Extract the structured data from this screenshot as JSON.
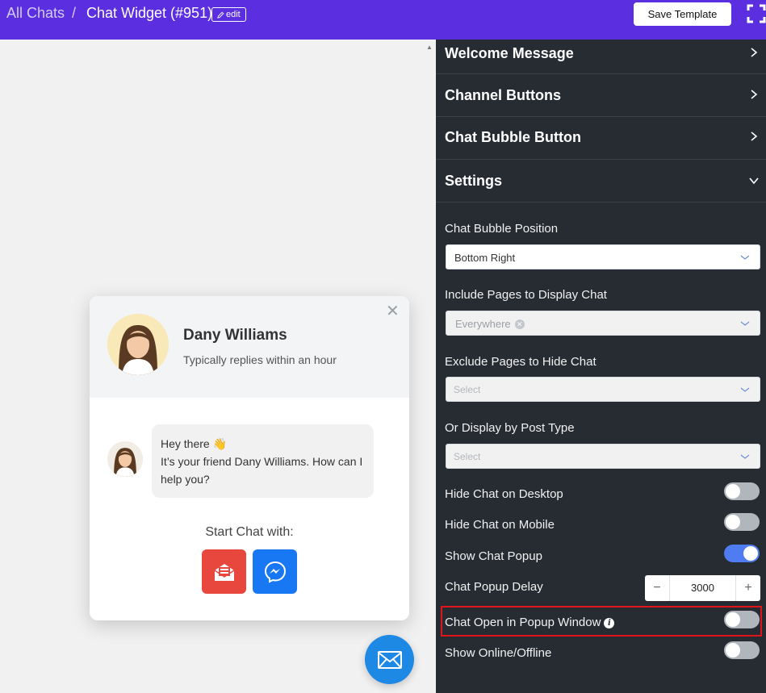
{
  "header": {
    "breadcrumb_root": "All Chats",
    "breadcrumb_sep": "/",
    "breadcrumb_current": "Chat Widget (#951)",
    "edit_label": "edit",
    "save_label": "Save Template",
    "background_color": "#5b2ee0"
  },
  "widget": {
    "agent_name": "Dany Williams",
    "agent_status": "Typically replies within an hour",
    "close_icon": "close-icon",
    "message_line1": "Hey there 👋",
    "message_line2": "It’s your friend Dany Williams. How can I help you?",
    "start_chat_label": "Start Chat with:",
    "channels": [
      {
        "icon": "email-icon",
        "color": "#e8473e"
      },
      {
        "icon": "messenger-icon",
        "color": "#1877f2"
      }
    ],
    "fab_icon": "envelope-icon",
    "fab_color": "#1e88e5"
  },
  "panel": {
    "sections": [
      {
        "title": "Welcome Message",
        "expanded": false
      },
      {
        "title": "Channel Buttons",
        "expanded": false
      },
      {
        "title": "Chat Bubble Button",
        "expanded": false
      },
      {
        "title": "Settings",
        "expanded": true
      }
    ],
    "settings": {
      "bubble_position_label": "Chat Bubble Position",
      "bubble_position_value": "Bottom Right",
      "include_pages_label": "Include Pages to Display Chat",
      "include_pages_value": "Everywhere",
      "exclude_pages_label": "Exclude Pages to Hide Chat",
      "exclude_pages_placeholder": "Select",
      "post_type_label": "Or Display by Post Type",
      "post_type_placeholder": "Select",
      "hide_desktop_label": "Hide Chat on Desktop",
      "hide_desktop_on": false,
      "hide_mobile_label": "Hide Chat on Mobile",
      "hide_mobile_on": false,
      "show_popup_label": "Show Chat Popup",
      "show_popup_on": true,
      "popup_delay_label": "Chat Popup Delay",
      "popup_delay_value": "3000",
      "popup_delay_minus": "−",
      "popup_delay_plus": "+",
      "popup_window_label": "Chat Open in Popup Window",
      "popup_window_on": false,
      "online_offline_label": "Show Online/Offline",
      "online_offline_on": false
    },
    "accent_color": "#4f7cf0",
    "highlight_color": "#e0141a"
  }
}
